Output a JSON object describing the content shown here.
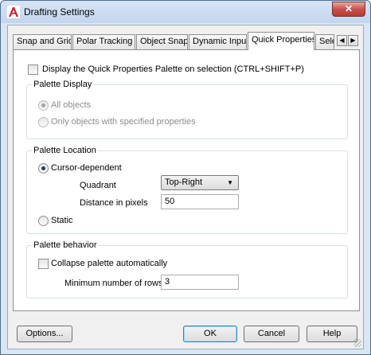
{
  "window": {
    "title": "Drafting Settings",
    "close_label": "✕",
    "accent": "#3c7fb1"
  },
  "tabs": [
    {
      "label": "Snap and Grid",
      "active": false
    },
    {
      "label": "Polar Tracking",
      "active": false
    },
    {
      "label": "Object Snap",
      "active": false
    },
    {
      "label": "Dynamic Input",
      "active": false
    },
    {
      "label": "Quick Properties",
      "active": true
    },
    {
      "label": "Sele",
      "active": false
    }
  ],
  "tab_scroll": {
    "left": "◀",
    "right": "▶"
  },
  "display_checkbox": {
    "label": "Display the Quick Properties Palette on selection (CTRL+SHIFT+P)",
    "checked": false
  },
  "palette_display": {
    "title": "Palette Display",
    "options": [
      {
        "label": "All objects",
        "selected": true,
        "enabled": false
      },
      {
        "label": "Only objects with specified properties",
        "selected": false,
        "enabled": false
      }
    ]
  },
  "palette_location": {
    "title": "Palette Location",
    "cursor_dependent": {
      "label": "Cursor-dependent",
      "selected": true
    },
    "quadrant": {
      "label": "Quadrant",
      "value": "Top-Right"
    },
    "distance": {
      "label": "Distance in pixels",
      "value": "50"
    },
    "static": {
      "label": "Static",
      "selected": false
    }
  },
  "palette_behavior": {
    "title": "Palette behavior",
    "collapse": {
      "label": "Collapse palette automatically",
      "checked": false
    },
    "min_rows": {
      "label": "Minimum number of rows",
      "value": "3"
    }
  },
  "buttons": {
    "options": "Options...",
    "ok": "OK",
    "cancel": "Cancel",
    "help": "Help"
  }
}
